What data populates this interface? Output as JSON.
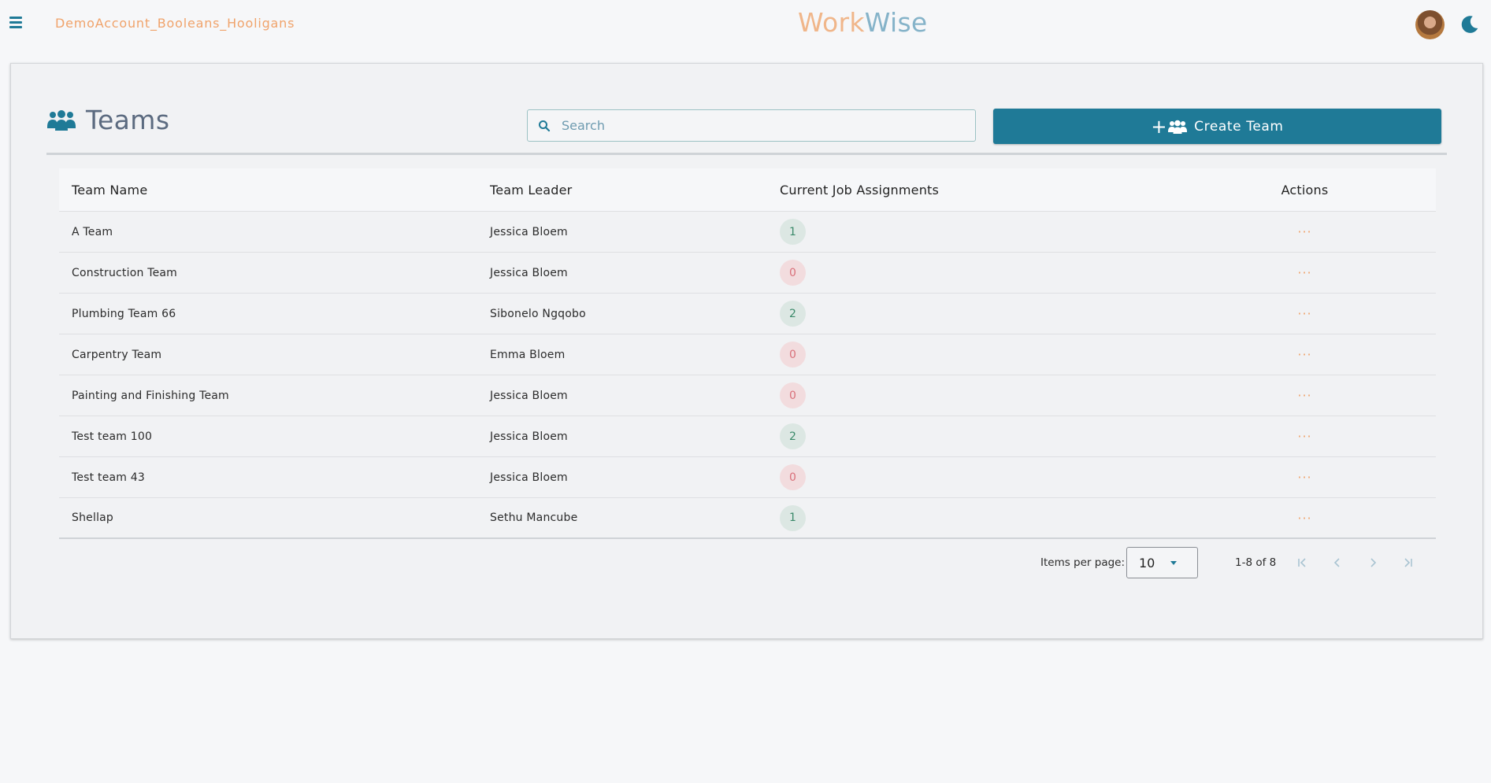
{
  "header": {
    "account_name": "DemoAccount_Booleans_Hooligans",
    "logo_part1": "Work",
    "logo_part2": "Wise",
    "icons": [
      "menu-icon",
      "avatar",
      "moon-icon"
    ]
  },
  "page": {
    "title": "Teams",
    "title_icon": "users-group-icon",
    "search_placeholder": "Search",
    "create_button_label": "Create Team"
  },
  "table": {
    "columns": [
      "Team Name",
      "Team Leader",
      "Current Job Assignments",
      "Actions"
    ],
    "rows": [
      {
        "name": "A Team",
        "leader": "Jessica Bloem",
        "assignments": "1",
        "actions": "···"
      },
      {
        "name": "Construction Team",
        "leader": "Jessica Bloem",
        "assignments": "0",
        "actions": "···"
      },
      {
        "name": "Plumbing Team 66",
        "leader": "Sibonelo Ngqobo",
        "assignments": "2",
        "actions": "···"
      },
      {
        "name": "Carpentry Team",
        "leader": "Emma Bloem",
        "assignments": "0",
        "actions": "···"
      },
      {
        "name": "Painting and Finishing Team",
        "leader": "Jessica Bloem",
        "assignments": "0",
        "actions": "···"
      },
      {
        "name": "Test team 100",
        "leader": "Jessica Bloem",
        "assignments": "2",
        "actions": "···"
      },
      {
        "name": "Test team 43",
        "leader": "Jessica Bloem",
        "assignments": "0",
        "actions": "···"
      },
      {
        "name": "Shellap",
        "leader": "Sethu Mancube",
        "assignments": "1",
        "actions": "···"
      }
    ]
  },
  "paginator": {
    "items_per_page_label": "Items per page:",
    "items_per_page": "10",
    "range": "1-8 of 8"
  },
  "colors": {
    "primary": "#1f7a97",
    "accent": "#f0a36b",
    "badge_positive_bg": "#dce7e3",
    "badge_zero_bg": "#f2dcde"
  }
}
